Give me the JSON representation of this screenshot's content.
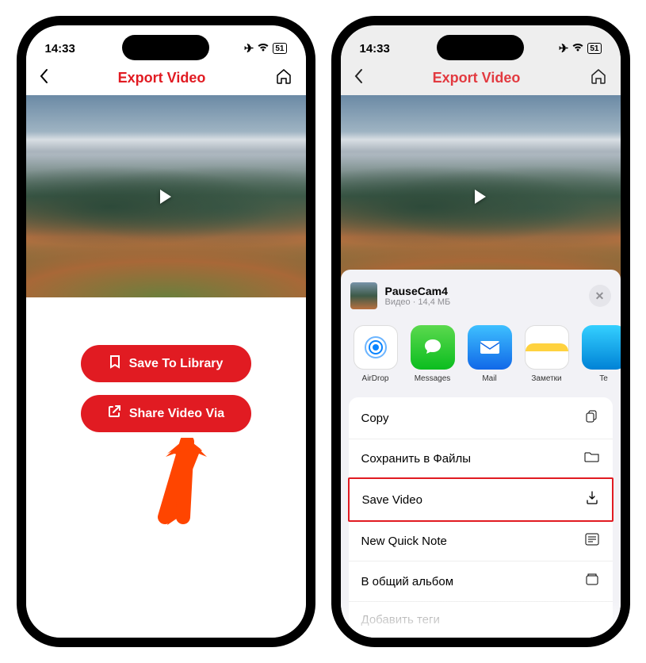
{
  "status": {
    "time": "14:33",
    "battery": "51"
  },
  "nav": {
    "title": "Export Video"
  },
  "buttons": {
    "save_library": "Save To Library",
    "share_via": "Share Video Via"
  },
  "sheet": {
    "file_name": "PauseCam4",
    "file_meta": "Видео · 14,4 МБ",
    "apps": [
      {
        "label": "AirDrop"
      },
      {
        "label": "Messages"
      },
      {
        "label": "Mail"
      },
      {
        "label": "Заметки"
      },
      {
        "label": "Te"
      }
    ],
    "actions": [
      {
        "label": "Copy",
        "icon": "copy-icon"
      },
      {
        "label": "Сохранить в Файлы",
        "icon": "folder-icon"
      },
      {
        "label": "Save Video",
        "icon": "download-icon",
        "highlighted": true
      },
      {
        "label": "New Quick Note",
        "icon": "note-icon"
      },
      {
        "label": "В общий альбом",
        "icon": "album-icon"
      },
      {
        "label": "Добавить теги",
        "icon": "tag-icon"
      }
    ]
  }
}
